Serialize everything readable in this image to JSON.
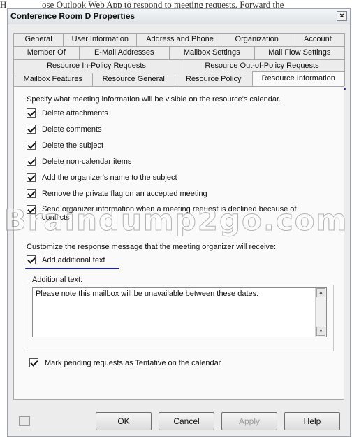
{
  "background_text": "ose Outlook Web App to respond to meeting requests. Forward the",
  "background_lead": "H",
  "window": {
    "title": "Conference Room D Properties",
    "close_glyph": "×"
  },
  "tabs": {
    "row1": [
      "General",
      "User Information",
      "Address and Phone",
      "Organization",
      "Account"
    ],
    "row2": [
      "Member Of",
      "E-Mail Addresses",
      "Mailbox Settings",
      "Mail Flow Settings"
    ],
    "row3": [
      "Resource In-Policy Requests",
      "Resource Out-of-Policy Requests"
    ],
    "row4": [
      "Mailbox Features",
      "Resource General",
      "Resource Policy",
      "Resource Information"
    ],
    "active": "Resource Information"
  },
  "panel": {
    "intro": "Specify what meeting information will be visible on the resource's calendar.",
    "options": [
      {
        "label": "Delete attachments",
        "checked": true
      },
      {
        "label": "Delete comments",
        "checked": true
      },
      {
        "label": "Delete the subject",
        "checked": true
      },
      {
        "label": "Delete non-calendar items",
        "checked": true
      },
      {
        "label": "Add the organizer's name to the subject",
        "checked": true
      },
      {
        "label": "Remove the private flag on an accepted meeting",
        "checked": true
      },
      {
        "label": "Send organizer information when a meeting request is declined because of",
        "label2": "conflicts",
        "checked": true
      }
    ],
    "customize_label": "Customize the response message that the meeting organizer will receive:",
    "add_text": {
      "label": "Add additional text",
      "checked": true
    },
    "additional_text_label": "Additional text:",
    "additional_text_value": "Please note this mailbox will be unavailable between these dates.",
    "tentative": {
      "label": "Mark pending requests as Tentative on the calendar",
      "checked": true
    }
  },
  "watermark": "Braindump2go.com",
  "buttons": {
    "ok": "OK",
    "cancel": "Cancel",
    "apply": "Apply",
    "help": "Help"
  },
  "colors": {
    "highlight": "#1a1fa8"
  }
}
